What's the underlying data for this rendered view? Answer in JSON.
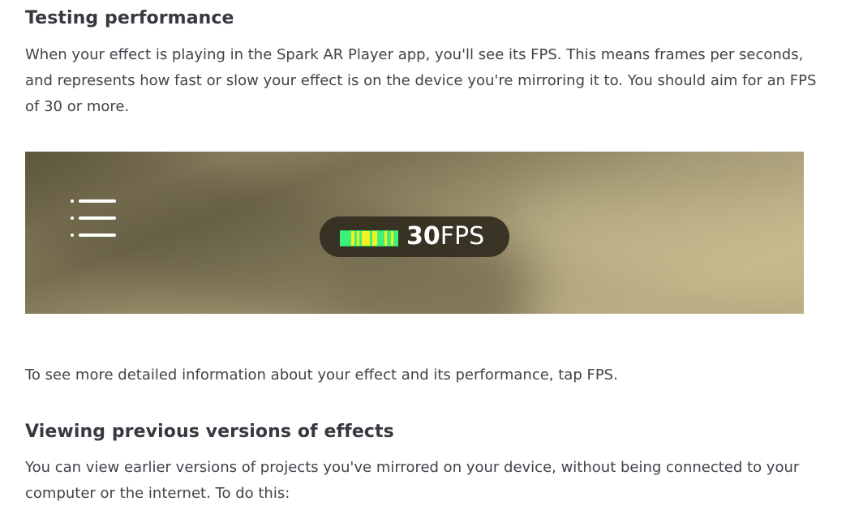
{
  "section_testing": {
    "heading": "Testing performance",
    "paragraph": "When your effect is playing in the Spark AR Player app, you'll see its FPS. This means frames per seconds, and represents how fast or slow your effect is on the device you're mirroring it to. You should aim for an FPS of 30 or more."
  },
  "figure": {
    "menu_icon": "menu-list-icon",
    "battery_icon": "performance-bar-icon",
    "fps_value": "30",
    "fps_unit": "FPS",
    "colors": {
      "pill_bg": "#322c20",
      "bar_green": "#3cf07a",
      "bar_yellow": "#f5f020"
    }
  },
  "tap_instruction": "To see more detailed information about your effect and its performance, tap FPS.",
  "section_viewing": {
    "heading": "Viewing previous versions of effects",
    "paragraph": "You can view earlier versions of projects you've mirrored on your device, without being connected to your computer or the internet. To do this:"
  }
}
